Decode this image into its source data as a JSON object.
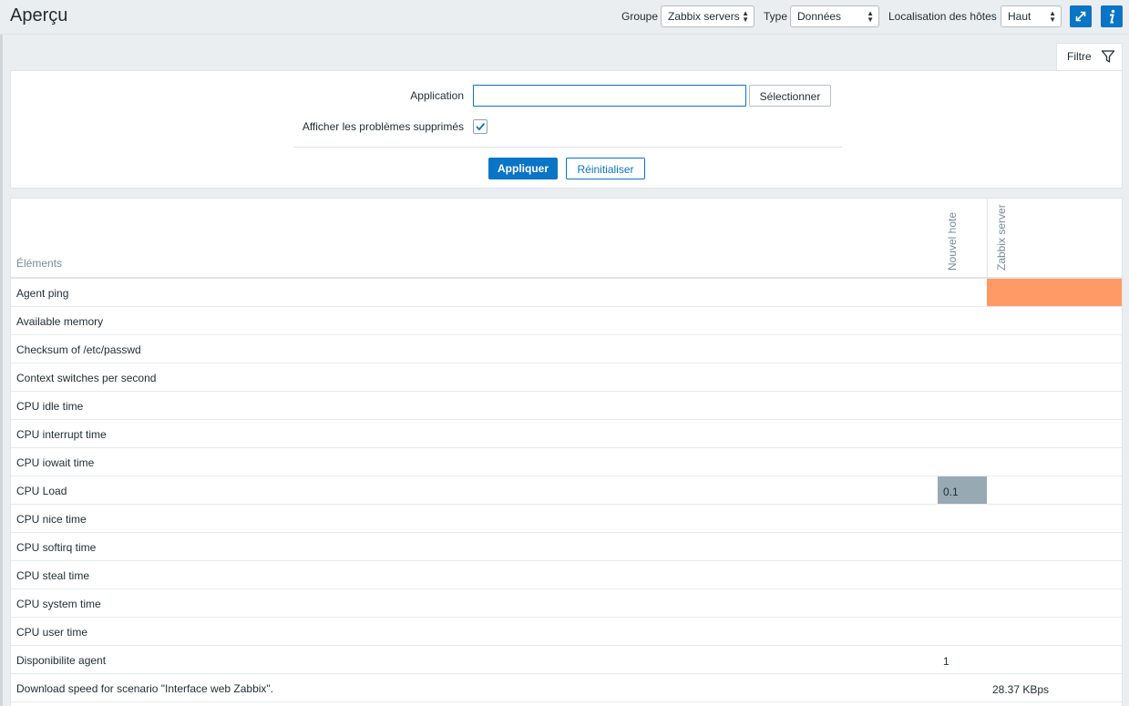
{
  "header": {
    "title": "Aperçu",
    "group_label": "Groupe",
    "group_value": "Zabbix servers",
    "type_label": "Type",
    "type_value": "Données",
    "location_label": "Localisation des hôtes",
    "location_value": "Haut",
    "fullscreen_icon": "fullscreen-icon",
    "info_icon": "info-icon"
  },
  "filter": {
    "tab_label": "Filtre",
    "application_label": "Application",
    "application_value": "",
    "select_button": "Sélectionner",
    "suppressed_label": "Afficher les problèmes supprimés",
    "suppressed_checked": true,
    "apply_button": "Appliquer",
    "reset_button": "Réinitialiser"
  },
  "table": {
    "header_elements": "Éléments",
    "hosts": [
      "Nouvel hote",
      "Zabbix server"
    ],
    "rows": [
      {
        "label": "Agent ping",
        "host1": "",
        "host2": "",
        "host2_color": "#ff9966"
      },
      {
        "label": "Available memory",
        "host1": "",
        "host2": ""
      },
      {
        "label": "Checksum of /etc/passwd",
        "host1": "",
        "host2": ""
      },
      {
        "label": "Context switches per second",
        "host1": "",
        "host2": ""
      },
      {
        "label": "CPU idle time",
        "host1": "",
        "host2": ""
      },
      {
        "label": "CPU interrupt time",
        "host1": "",
        "host2": ""
      },
      {
        "label": "CPU iowait time",
        "host1": "",
        "host2": ""
      },
      {
        "label": "CPU Load",
        "host1": "0.1",
        "host1_color": "#97aab3",
        "host2": ""
      },
      {
        "label": "CPU nice time",
        "host1": "",
        "host2": ""
      },
      {
        "label": "CPU softirq time",
        "host1": "",
        "host2": ""
      },
      {
        "label": "CPU steal time",
        "host1": "",
        "host2": ""
      },
      {
        "label": "CPU system time",
        "host1": "",
        "host2": ""
      },
      {
        "label": "CPU user time",
        "host1": "",
        "host2": ""
      },
      {
        "label": "Disponibilite agent",
        "host1": "1",
        "host2": ""
      },
      {
        "label": "Download speed for scenario \"Interface web Zabbix\".",
        "host1": "",
        "host2": "28.37 KBps"
      }
    ]
  },
  "colors": {
    "accent": "#0a74c6",
    "problem": "#ff9966",
    "info_cell": "#97aab3"
  }
}
